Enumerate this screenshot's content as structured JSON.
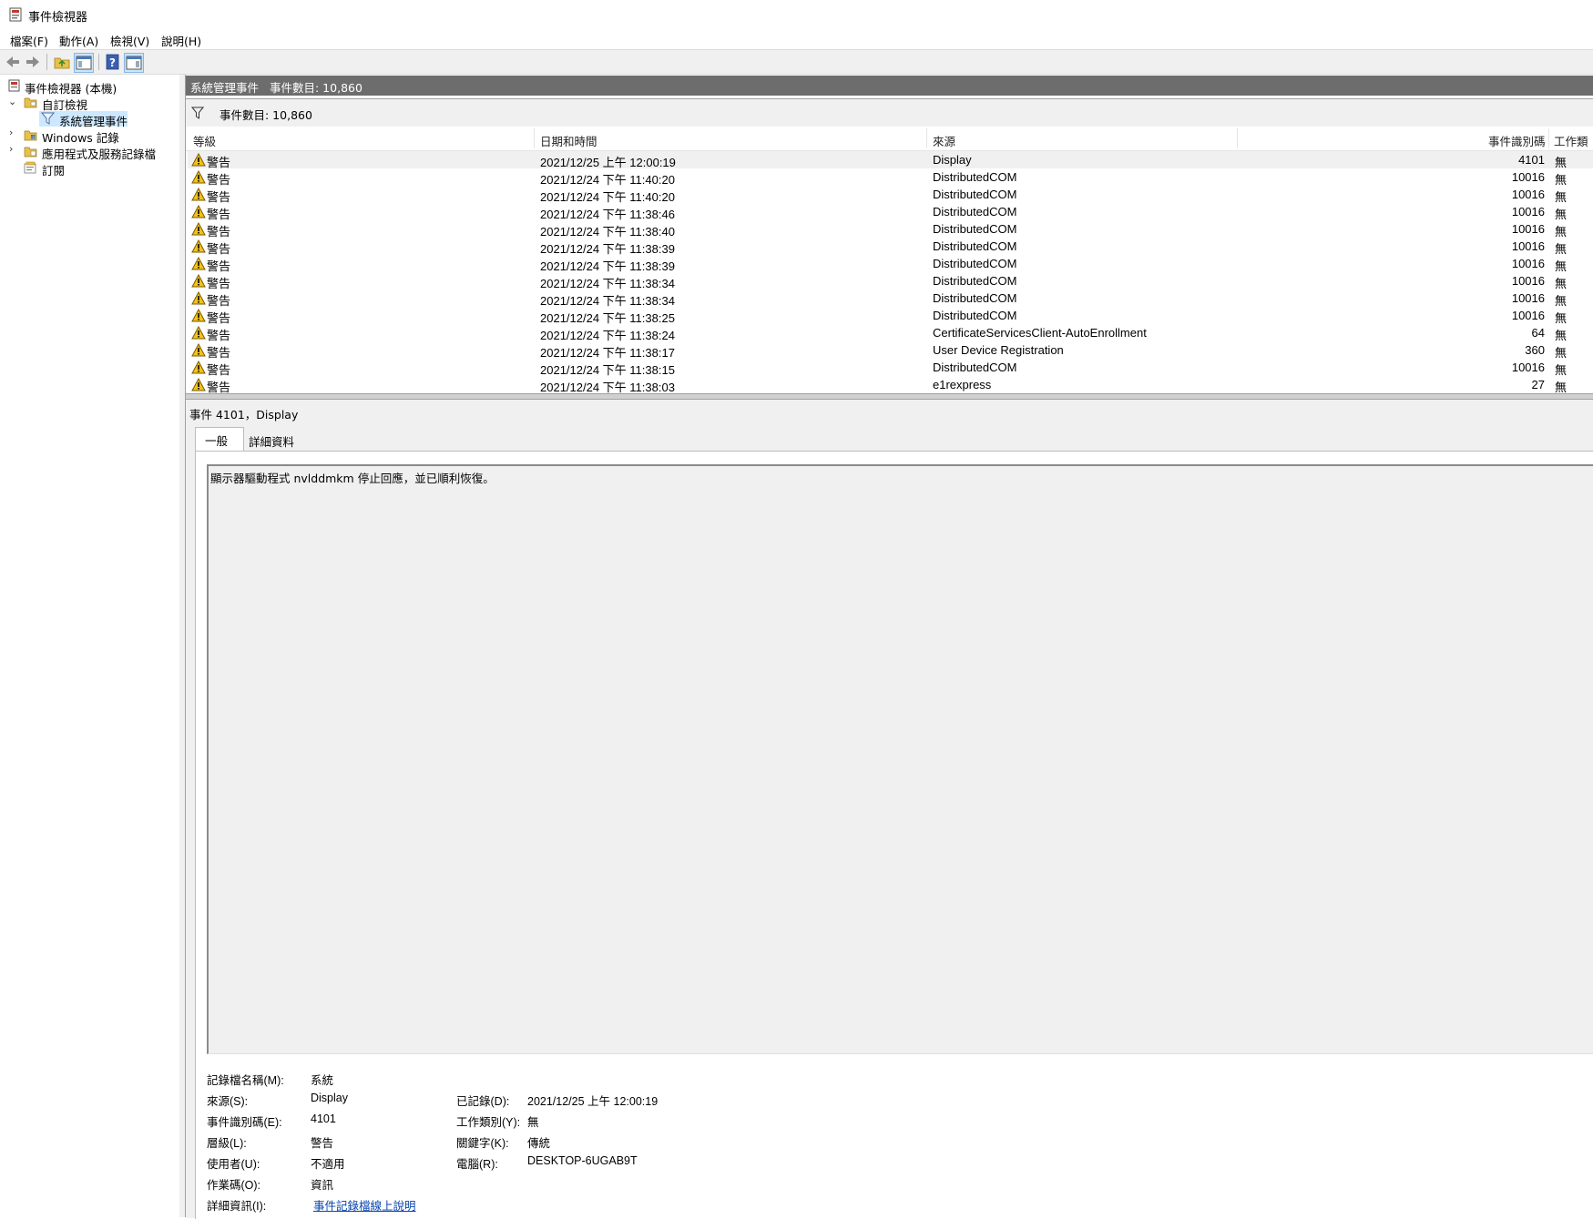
{
  "window": {
    "title": "事件檢視器"
  },
  "menu": [
    "檔案(F)",
    "動作(A)",
    "檢視(V)",
    "說明(H)"
  ],
  "tree": {
    "root": "事件檢視器 (本機)",
    "custom_views": "自訂檢視",
    "admin_events": "系統管理事件",
    "windows_logs": "Windows 記錄",
    "app_service_logs": "應用程式及服務記錄檔",
    "subscriptions": "訂閱"
  },
  "pane_header": {
    "title": "系統管理事件",
    "count": "事件數目: 10,860"
  },
  "filter_bar": {
    "text": "事件數目: 10,860"
  },
  "columns": {
    "level": "等級",
    "datetime": "日期和時間",
    "source": "來源",
    "event_id": "事件識別碼",
    "task_category": "工作類別"
  },
  "events": [
    {
      "level": "警告",
      "datetime": "2021/12/25 上午 12:00:19",
      "source": "Display",
      "event_id": "4101",
      "task": "無"
    },
    {
      "level": "警告",
      "datetime": "2021/12/24 下午 11:40:20",
      "source": "DistributedCOM",
      "event_id": "10016",
      "task": "無"
    },
    {
      "level": "警告",
      "datetime": "2021/12/24 下午 11:40:20",
      "source": "DistributedCOM",
      "event_id": "10016",
      "task": "無"
    },
    {
      "level": "警告",
      "datetime": "2021/12/24 下午 11:38:46",
      "source": "DistributedCOM",
      "event_id": "10016",
      "task": "無"
    },
    {
      "level": "警告",
      "datetime": "2021/12/24 下午 11:38:40",
      "source": "DistributedCOM",
      "event_id": "10016",
      "task": "無"
    },
    {
      "level": "警告",
      "datetime": "2021/12/24 下午 11:38:39",
      "source": "DistributedCOM",
      "event_id": "10016",
      "task": "無"
    },
    {
      "level": "警告",
      "datetime": "2021/12/24 下午 11:38:39",
      "source": "DistributedCOM",
      "event_id": "10016",
      "task": "無"
    },
    {
      "level": "警告",
      "datetime": "2021/12/24 下午 11:38:34",
      "source": "DistributedCOM",
      "event_id": "10016",
      "task": "無"
    },
    {
      "level": "警告",
      "datetime": "2021/12/24 下午 11:38:34",
      "source": "DistributedCOM",
      "event_id": "10016",
      "task": "無"
    },
    {
      "level": "警告",
      "datetime": "2021/12/24 下午 11:38:25",
      "source": "DistributedCOM",
      "event_id": "10016",
      "task": "無"
    },
    {
      "level": "警告",
      "datetime": "2021/12/24 下午 11:38:24",
      "source": "CertificateServicesClient-AutoEnrollment",
      "event_id": "64",
      "task": "無"
    },
    {
      "level": "警告",
      "datetime": "2021/12/24 下午 11:38:17",
      "source": "User Device Registration",
      "event_id": "360",
      "task": "無"
    },
    {
      "level": "警告",
      "datetime": "2021/12/24 下午 11:38:15",
      "source": "DistributedCOM",
      "event_id": "10016",
      "task": "無"
    },
    {
      "level": "警告",
      "datetime": "2021/12/24 下午 11:38:03",
      "source": "e1rexpress",
      "event_id": "27",
      "task": "無"
    }
  ],
  "detail": {
    "title": "事件 4101，Display",
    "tabs": [
      "一般",
      "詳細資料"
    ],
    "description": "顯示器驅動程式 nvlddmkm 停止回應，並已順利恢復。",
    "labels": {
      "log_name": "記錄檔名稱(M):",
      "source": "來源(S):",
      "event_id": "事件識別碼(E):",
      "level": "層級(L):",
      "user": "使用者(U):",
      "opcode": "作業碼(O):",
      "more_info": "詳細資訊(I):",
      "logged": "已記錄(D):",
      "task_category": "工作類別(Y):",
      "keywords": "關鍵字(K):",
      "computer": "電腦(R):"
    },
    "values": {
      "log_name": "系統",
      "source": "Display",
      "event_id": "4101",
      "level": "警告",
      "user": "不適用",
      "opcode": "資訊",
      "more_info": "事件記錄檔線上說明",
      "logged": "2021/12/25 上午 12:00:19",
      "task_category": "無",
      "keywords": "傳統",
      "computer": "DESKTOP-6UGAB9T"
    }
  }
}
